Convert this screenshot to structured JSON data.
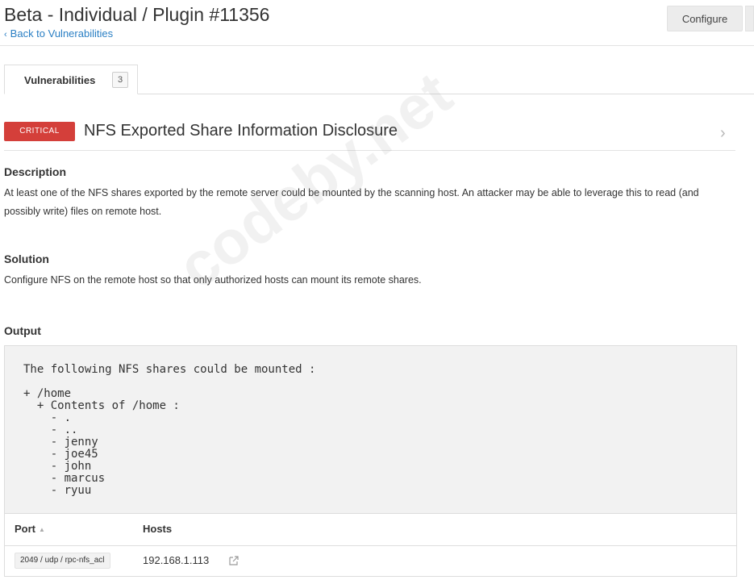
{
  "header": {
    "title": "Beta - Individual / Plugin #11356",
    "back_link": "Back to Vulnerabilities",
    "configure_label": "Configure"
  },
  "tabs": [
    {
      "label": "Vulnerabilities",
      "count": "3"
    }
  ],
  "vulnerability": {
    "severity": "CRITICAL",
    "severity_color": "#d43f3a",
    "title": "NFS Exported Share Information Disclosure",
    "description_title": "Description",
    "description": "At least one of the NFS shares exported by the remote server could be mounted by the scanning host. An attacker may be able to leverage this to read (and possibly write) files on remote host.",
    "solution_title": "Solution",
    "solution": "Configure NFS on the remote host so that only authorized hosts can mount its remote shares.",
    "output_title": "Output",
    "output": "The following NFS shares could be mounted :\n\n+ /home\n  + Contents of /home :\n    - .\n    - ..\n    - jenny\n    - joe45\n    - john\n    - marcus\n    - ryuu"
  },
  "table": {
    "columns": [
      "Port",
      "Hosts"
    ],
    "rows": [
      {
        "port": "2049 / udp / rpc-nfs_acl",
        "host": "192.168.1.113"
      }
    ]
  },
  "watermark": "codeby.net",
  "colors": {
    "link": "#2a7fc4",
    "critical": "#d43f3a"
  }
}
